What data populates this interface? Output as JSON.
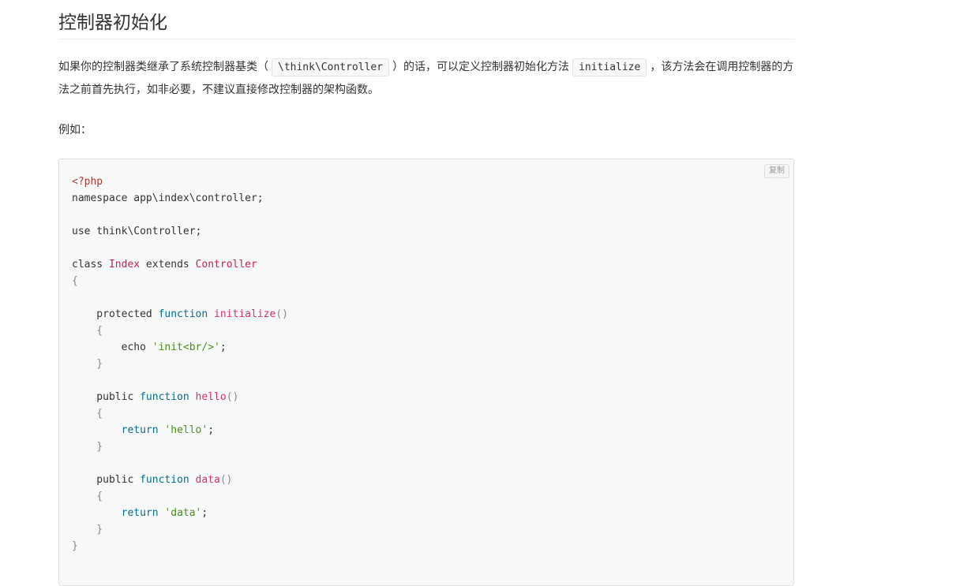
{
  "heading": "控制器初始化",
  "para1": {
    "text_a": "如果你的控制器类继承了系统控制器基类（",
    "code_a": "\\think\\Controller",
    "text_b": "）的话，可以定义控制器初始化方法",
    "code_b": "initialize",
    "text_c": "，该方法会在调用控制器的方法之前首先执行，如非必要，不建议直接修改控制器的架构函数。"
  },
  "para2": "例如：",
  "copy_label": "复制",
  "code_lines": [
    [
      {
        "t": "<?php",
        "c": "meta"
      }
    ],
    [
      {
        "t": "namespace app\\index\\controller;",
        "c": ""
      }
    ],
    [],
    [
      {
        "t": "use think\\Controller;",
        "c": ""
      }
    ],
    [],
    [
      {
        "t": "class ",
        "c": ""
      },
      {
        "t": "Index",
        "c": "title"
      },
      {
        "t": " extends ",
        "c": ""
      },
      {
        "t": "Controller",
        "c": "title"
      }
    ],
    [
      {
        "t": "{",
        "c": "punct"
      }
    ],
    [],
    [
      {
        "t": "    protected ",
        "c": ""
      },
      {
        "t": "function",
        "c": "kw"
      },
      {
        "t": " ",
        "c": ""
      },
      {
        "t": "initialize",
        "c": "fn"
      },
      {
        "t": "()",
        "c": "punct"
      }
    ],
    [
      {
        "t": "    {",
        "c": "punct"
      }
    ],
    [
      {
        "t": "        echo ",
        "c": ""
      },
      {
        "t": "'init<br/>'",
        "c": "str"
      },
      {
        "t": ";",
        "c": ""
      }
    ],
    [
      {
        "t": "    }",
        "c": "punct"
      }
    ],
    [],
    [
      {
        "t": "    public ",
        "c": ""
      },
      {
        "t": "function",
        "c": "kw"
      },
      {
        "t": " ",
        "c": ""
      },
      {
        "t": "hello",
        "c": "fn"
      },
      {
        "t": "()",
        "c": "punct"
      }
    ],
    [
      {
        "t": "    {",
        "c": "punct"
      }
    ],
    [
      {
        "t": "        ",
        "c": ""
      },
      {
        "t": "return",
        "c": "kw"
      },
      {
        "t": " ",
        "c": ""
      },
      {
        "t": "'hello'",
        "c": "str"
      },
      {
        "t": ";",
        "c": ""
      }
    ],
    [
      {
        "t": "    }",
        "c": "punct"
      }
    ],
    [],
    [
      {
        "t": "    public ",
        "c": ""
      },
      {
        "t": "function",
        "c": "kw"
      },
      {
        "t": " ",
        "c": ""
      },
      {
        "t": "data",
        "c": "fn"
      },
      {
        "t": "()",
        "c": "punct"
      }
    ],
    [
      {
        "t": "    {",
        "c": "punct"
      }
    ],
    [
      {
        "t": "        ",
        "c": ""
      },
      {
        "t": "return",
        "c": "kw"
      },
      {
        "t": " ",
        "c": ""
      },
      {
        "t": "'data'",
        "c": "str"
      },
      {
        "t": ";",
        "c": ""
      }
    ],
    [
      {
        "t": "    }",
        "c": "punct"
      }
    ],
    [
      {
        "t": "}",
        "c": "punct"
      }
    ]
  ]
}
